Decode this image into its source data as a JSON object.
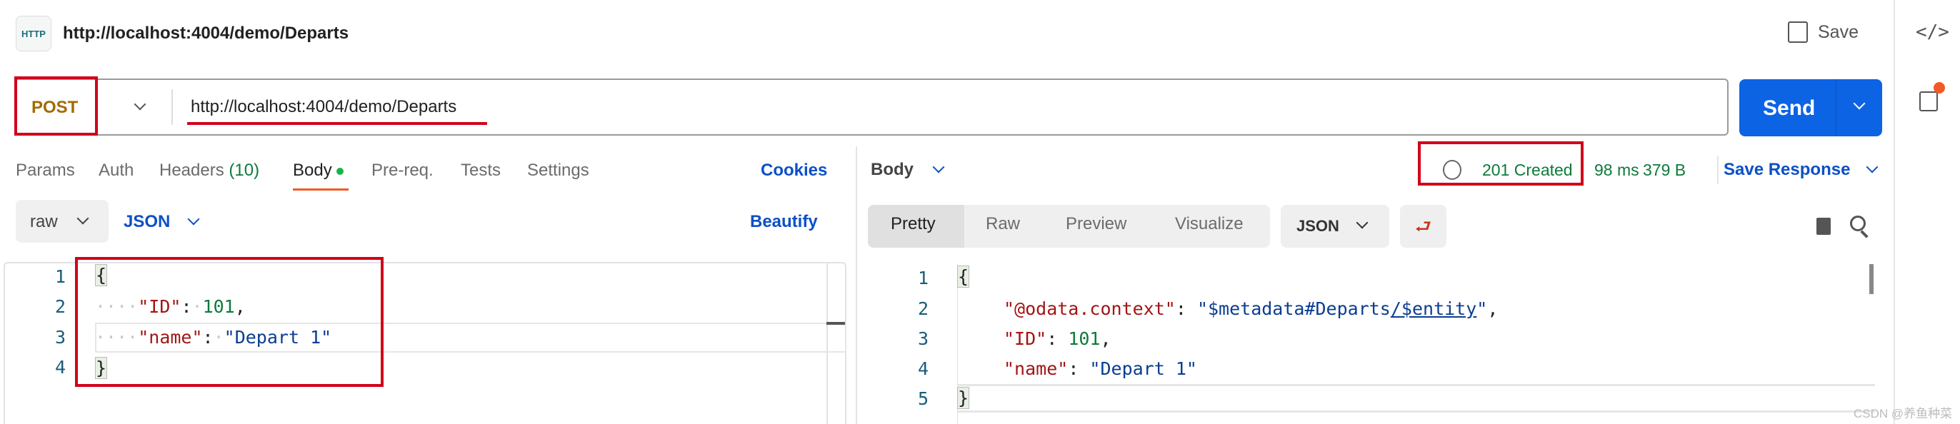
{
  "header": {
    "icon": "http-icon",
    "title": "http://localhost:4004/demo/Departs",
    "save_label": "Save"
  },
  "request": {
    "method": "POST",
    "url": "http://localhost:4004/demo/Departs",
    "send_label": "Send"
  },
  "tabs": [
    {
      "label": "Params"
    },
    {
      "label": "Auth"
    },
    {
      "label": "Headers",
      "count": "(10)"
    },
    {
      "label": "Body",
      "active": true
    },
    {
      "label": "Pre-req."
    },
    {
      "label": "Tests"
    },
    {
      "label": "Settings"
    }
  ],
  "cookies_label": "Cookies",
  "body_options": {
    "mode": "raw",
    "format": "JSON",
    "beautify_label": "Beautify"
  },
  "request_body": {
    "line_numbers": [
      "1",
      "2",
      "3",
      "4"
    ],
    "brace_open": "{",
    "brace_close": "}",
    "k1": "\"ID\"",
    "v1": "101",
    "k2": "\"name\"",
    "v2": "\"Depart 1\""
  },
  "response": {
    "body_label": "Body",
    "status": "201 Created",
    "time": "98 ms",
    "size": "379 B",
    "save_response_label": "Save Response",
    "views": [
      "Pretty",
      "Raw",
      "Preview",
      "Visualize"
    ],
    "active_view": "Pretty",
    "format": "JSON",
    "line_numbers": [
      "1",
      "2",
      "3",
      "4",
      "5"
    ],
    "brace_open": "{",
    "brace_close": "}",
    "k1": "\"@odata.context\"",
    "v1a": "\"$metadata#Departs",
    "v1b": "/$entity",
    "v1c": "\"",
    "k2": "\"ID\"",
    "v2": "101",
    "k3": "\"name\"",
    "v3": "\"Depart 1\""
  },
  "colors": {
    "accent": "#0c63e4",
    "status_ok": "#0e7a3a",
    "method_post": "#a26b00",
    "highlight": "#d0021b",
    "tab_indicator": "#f15a24"
  },
  "watermark": "CSDN @养鱼种菜"
}
